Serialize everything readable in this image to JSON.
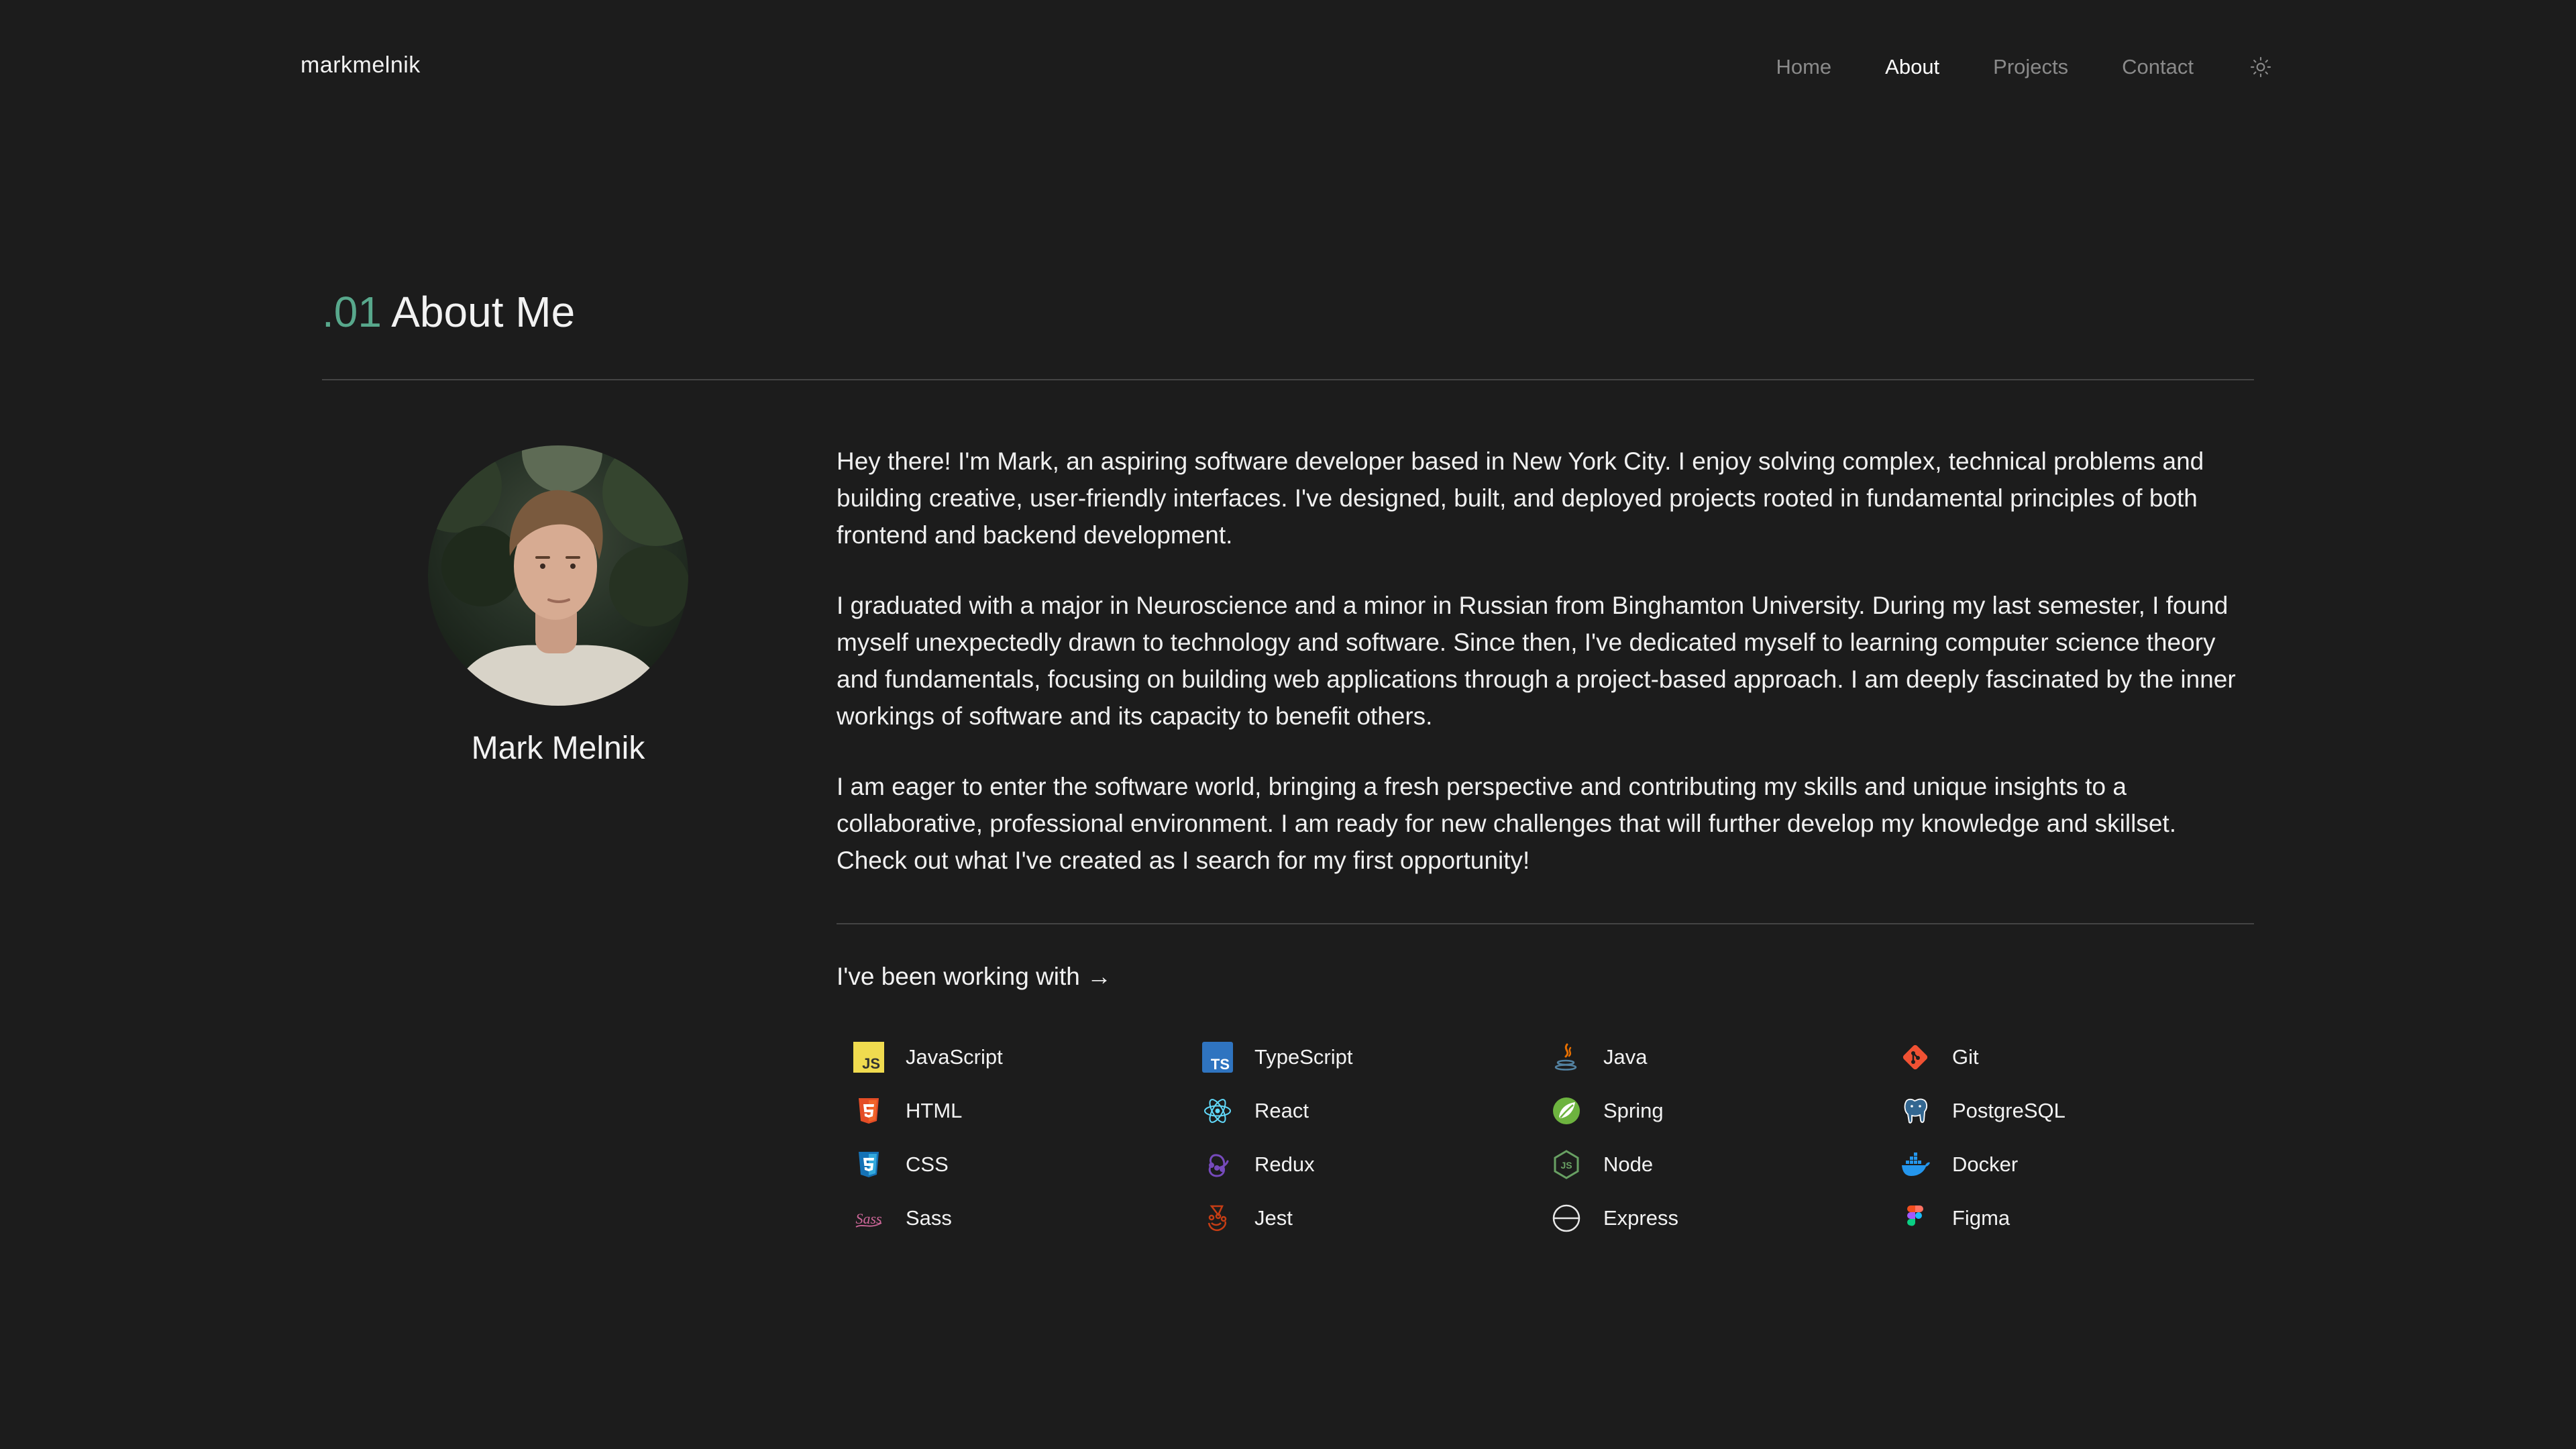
{
  "header": {
    "logo": "markmelnik",
    "nav": [
      {
        "label": "Home",
        "active": false
      },
      {
        "label": "About",
        "active": true
      },
      {
        "label": "Projects",
        "active": false
      },
      {
        "label": "Contact",
        "active": false
      }
    ],
    "theme_icon": "sun-icon"
  },
  "section": {
    "number": ".01",
    "title": "About Me",
    "accent_color": "#58a88c"
  },
  "profile": {
    "name": "Mark Melnik"
  },
  "bio": {
    "paragraphs": [
      "Hey there! I'm Mark, an aspiring software developer based in New York City. I enjoy solving complex, technical problems and building creative, user-friendly interfaces. I've designed, built, and deployed projects rooted in fundamental principles of both frontend and backend development.",
      "I graduated with a major in Neuroscience and a minor in Russian from Binghamton University. During my last semester, I found myself unexpectedly drawn to technology and software. Since then, I've dedicated myself to learning computer science theory and fundamentals, focusing on building web applications through a project-based approach. I am deeply fascinated by the inner workings of software and its capacity to benefit others.",
      "I am eager to enter the software world, bringing a fresh perspective and contributing my skills and unique insights to a collaborative, professional environment. I am ready for new challenges that will further develop my knowledge and skillset. Check out what I've created as I search for my first opportunity!"
    ]
  },
  "working_with": {
    "label": "I've been working with →"
  },
  "tech": [
    {
      "label": "JavaScript",
      "icon": "javascript-icon"
    },
    {
      "label": "TypeScript",
      "icon": "typescript-icon"
    },
    {
      "label": "Java",
      "icon": "java-icon"
    },
    {
      "label": "Git",
      "icon": "git-icon"
    },
    {
      "label": "HTML",
      "icon": "html-icon"
    },
    {
      "label": "React",
      "icon": "react-icon"
    },
    {
      "label": "Spring",
      "icon": "spring-icon"
    },
    {
      "label": "PostgreSQL",
      "icon": "postgresql-icon"
    },
    {
      "label": "CSS",
      "icon": "css-icon"
    },
    {
      "label": "Redux",
      "icon": "redux-icon"
    },
    {
      "label": "Node",
      "icon": "node-icon"
    },
    {
      "label": "Docker",
      "icon": "docker-icon"
    },
    {
      "label": "Sass",
      "icon": "sass-icon"
    },
    {
      "label": "Jest",
      "icon": "jest-icon"
    },
    {
      "label": "Express",
      "icon": "express-icon"
    },
    {
      "label": "Figma",
      "icon": "figma-icon"
    }
  ]
}
